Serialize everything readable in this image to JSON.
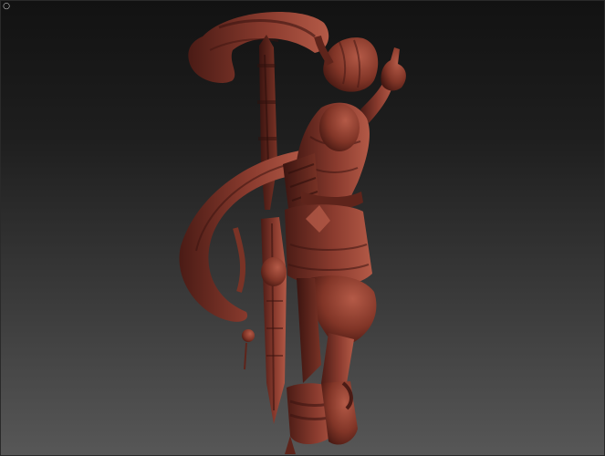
{
  "viewport": {
    "corner_glyph": "○",
    "icon_name": "view-marker-icon",
    "model": {
      "type": "sculpted 3D character figure",
      "material_color": "#8a3b2e",
      "material_shadow": "#4a1b15",
      "material_highlight": "#b45a47"
    },
    "background": {
      "top_color": "#121212",
      "bottom_color": "#575757"
    }
  }
}
